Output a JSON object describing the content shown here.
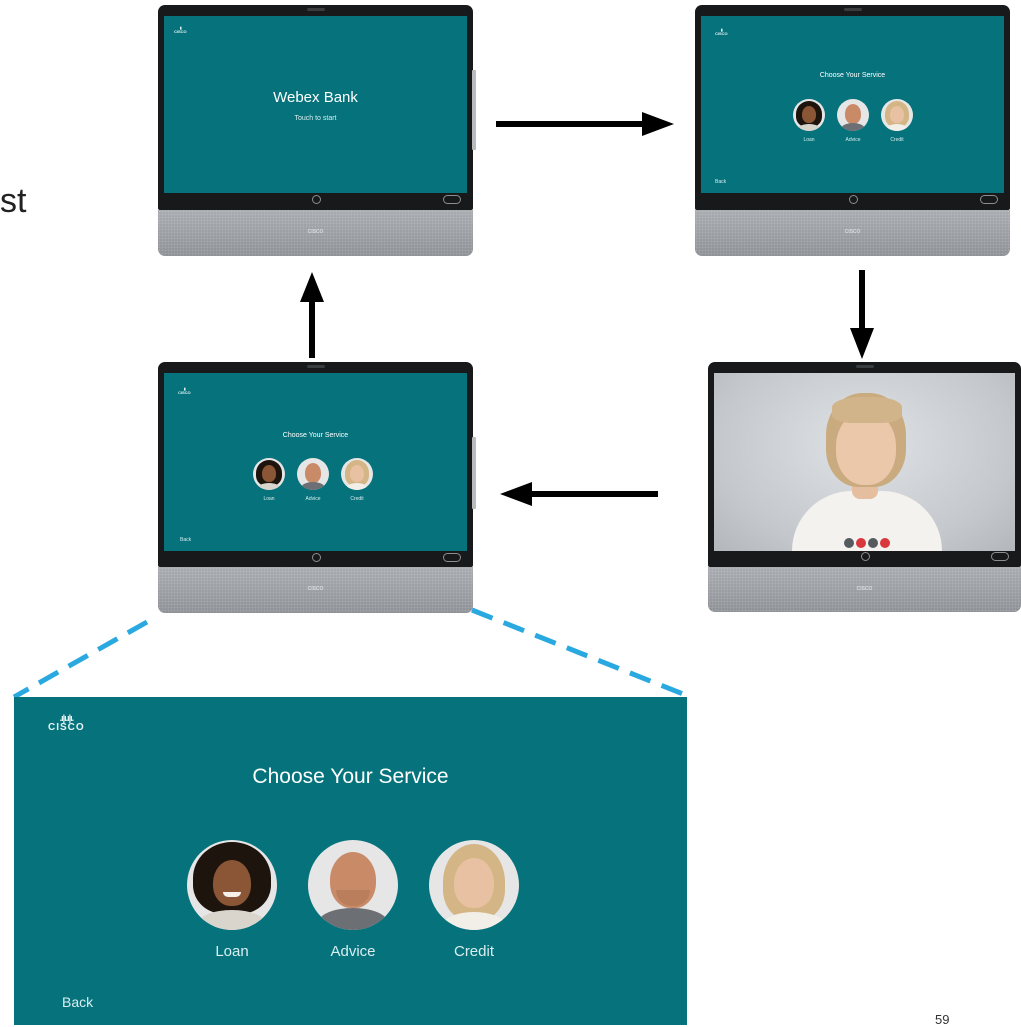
{
  "side_text": "st",
  "page_number": "59",
  "colors": {
    "screen_teal": "#06737c",
    "dash_blue": "#29a9e0",
    "accent_red": "#d9373b"
  },
  "logo": {
    "bars": ".ı|ı.ı|ı.",
    "word": "CISCO"
  },
  "device_welcome": {
    "title": "Webex Bank",
    "subtitle": "Touch to start"
  },
  "device_menu": {
    "title": "Choose Your Service",
    "options": [
      "Loan",
      "Advice",
      "Credit"
    ],
    "back": "Back"
  },
  "detail": {
    "title": "Choose Your Service",
    "options": [
      "Loan",
      "Advice",
      "Credit"
    ],
    "back": "Back"
  },
  "icons": [
    "arrow-right-icon",
    "arrow-down-icon",
    "arrow-left-icon",
    "arrow-up-icon",
    "home-button-icon",
    "cisco-logo-icon"
  ]
}
